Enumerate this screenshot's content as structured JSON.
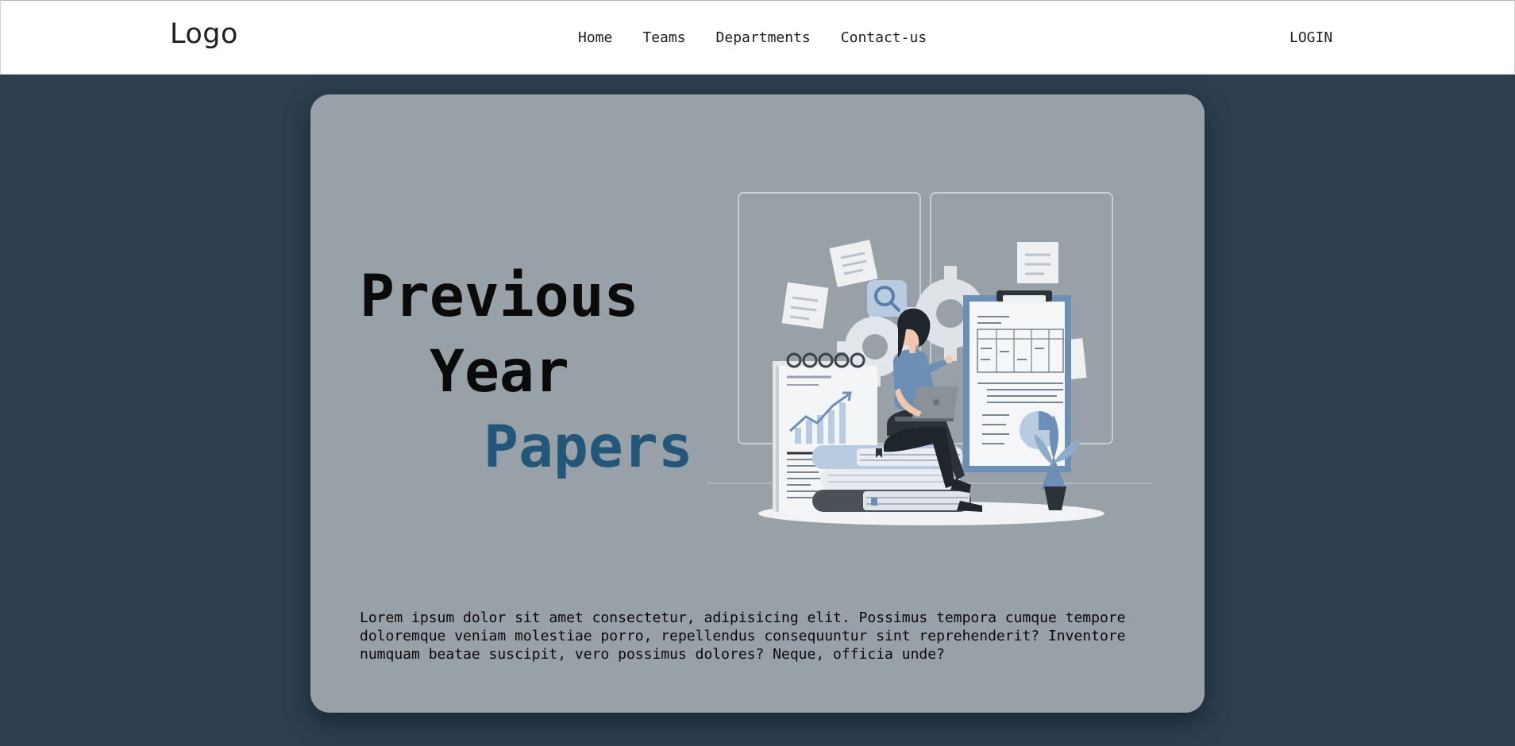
{
  "navbar": {
    "logo": "Logo",
    "links": [
      "Home",
      "Teams",
      "Departments",
      "Contact-us"
    ],
    "login": "LOGIN"
  },
  "hero": {
    "title_line1": "Previous",
    "title_line2": "Year",
    "title_line3": "Papers",
    "description": "Lorem ipsum dolor sit amet consectetur, adipisicing elit. Possimus tempora cumque tempore doloremque veniam molestiae porro, repellendus consequuntur sint reprehenderit? Inventore numquam beatae suscipit, vero possimus dolores? Neque, officia unde?"
  },
  "colors": {
    "page_background": "#2d3e4e",
    "card_background": "#98a0a8",
    "accent": "#22577a",
    "illustration_blue": "#6d8fb5"
  },
  "illustration": {
    "icons": [
      "search-icon",
      "gear-icon",
      "chart-icon",
      "plant-icon",
      "clipboard-icon",
      "books-icon"
    ]
  }
}
